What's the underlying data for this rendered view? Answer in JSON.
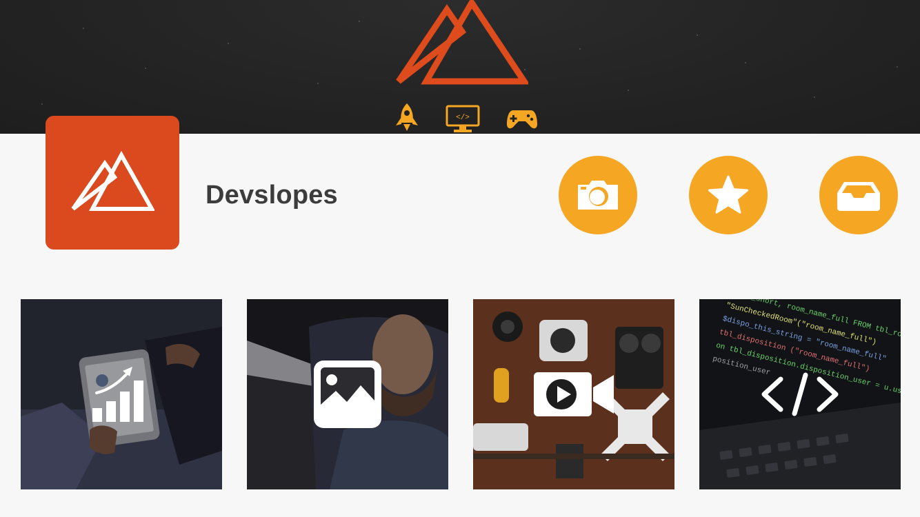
{
  "app": {
    "profile_name": "Devslopes"
  },
  "banner": {
    "logo_icon": "mountain-logo-icon",
    "categories": [
      {
        "name": "rocket-icon",
        "color": "#f5a623"
      },
      {
        "name": "code-monitor-icon",
        "color": "#f5a623"
      },
      {
        "name": "gamepad-icon",
        "color": "#f5a623"
      }
    ]
  },
  "profile": {
    "avatar_icon": "mountain-logo-icon",
    "avatar_color": "#db4a1e"
  },
  "actions": [
    {
      "name": "camera-icon"
    },
    {
      "name": "star-icon"
    },
    {
      "name": "inbox-icon"
    }
  ],
  "tiles": [
    {
      "name": "analytics-icon"
    },
    {
      "name": "image-icon"
    },
    {
      "name": "video-camera-icon"
    },
    {
      "name": "code-icon"
    }
  ],
  "colors": {
    "accent": "#f5a623",
    "brand": "#db4a1e",
    "banner_bg": "#232323",
    "text": "#3c3c3c"
  }
}
